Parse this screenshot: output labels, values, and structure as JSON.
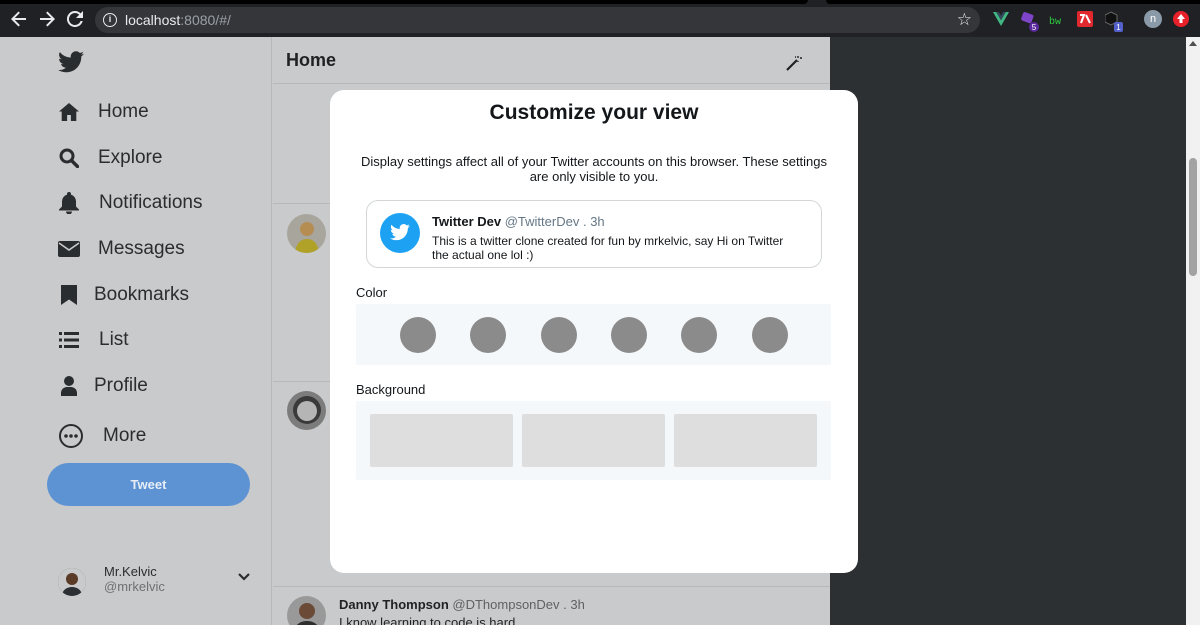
{
  "browser": {
    "url_host": "localhost",
    "url_rest": ":8080/#/",
    "ext_badge_1": "5",
    "ext_label_bw": "bw",
    "ext_badge_2": "1",
    "profile_initial": "n"
  },
  "sidebar": {
    "items": [
      {
        "label": "Home",
        "icon": "home-icon"
      },
      {
        "label": "Explore",
        "icon": "search-icon"
      },
      {
        "label": "Notifications",
        "icon": "bell-icon"
      },
      {
        "label": "Messages",
        "icon": "envelope-icon"
      },
      {
        "label": "Bookmarks",
        "icon": "bookmark-icon"
      },
      {
        "label": "List",
        "icon": "list-icon"
      },
      {
        "label": "Profile",
        "icon": "user-icon"
      },
      {
        "label": "More",
        "icon": "more-icon"
      }
    ],
    "tweet_label": "Tweet",
    "account": {
      "name": "Mr.Kelvic",
      "handle": "@mrkelvic"
    }
  },
  "feed": {
    "title": "Home",
    "post": {
      "name": "Danny Thompson",
      "handle": "@DThompsonDev",
      "time": ". 3h",
      "text": "I know learning to code is hard"
    }
  },
  "modal": {
    "title": "Customize your view",
    "description": "Display settings affect all of your Twitter accounts on this browser. These settings are only visible to you.",
    "preview": {
      "name": "Twitter Dev",
      "handle": "@TwitterDev",
      "time": ". 3h",
      "text": "This is a twitter clone created for fun by mrkelvic, say Hi on Twitter the actual one lol :)"
    },
    "color_label": "Color",
    "background_label": "Background",
    "swatch_color": "#8b8b8b",
    "swatch_count": 6,
    "background_option_count": 3
  },
  "colors": {
    "twitter_blue": "#1da1f2",
    "tweet_button": "#5d93d3",
    "overlay": "#c9cacb"
  }
}
